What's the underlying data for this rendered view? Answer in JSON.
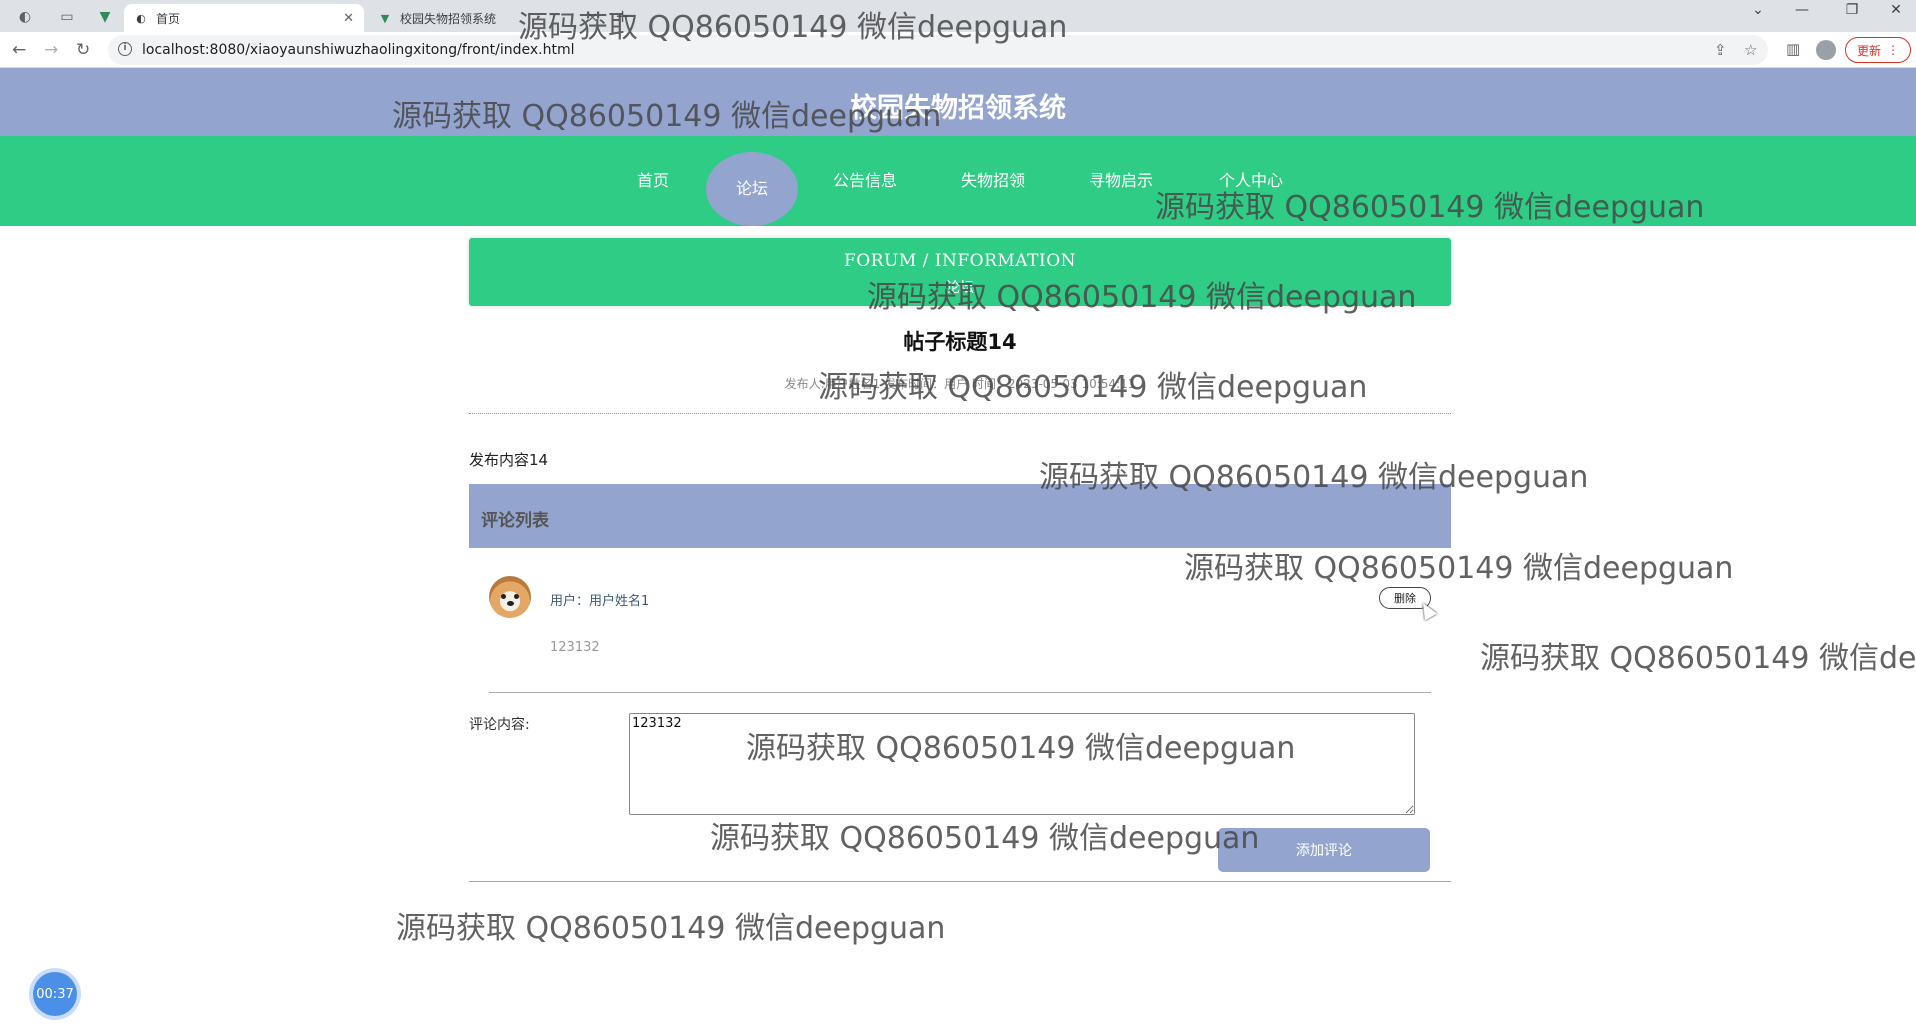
{
  "browser": {
    "tabs": [
      {
        "title": "首页",
        "active": true
      },
      {
        "title": "校园失物招领系统",
        "active": false
      }
    ],
    "url": "localhost:8080/xiaoyaunshiwuzhaolingxitong/front/index.html",
    "update_label": "更新"
  },
  "site": {
    "title": "校园失物招领系统",
    "nav": [
      {
        "label": "首页",
        "active": false
      },
      {
        "label": "论坛",
        "active": true
      },
      {
        "label": "公告信息",
        "active": false
      },
      {
        "label": "失物招领",
        "active": false
      },
      {
        "label": "寻物启示",
        "active": false
      },
      {
        "label": "个人中心",
        "active": false
      }
    ]
  },
  "banner": {
    "en": "FORUM / INFORMATION",
    "zh": "论坛"
  },
  "post": {
    "title": "帖子标题14",
    "meta": "发布人:用户姓名1   发布时间：用户   时间：2023-05-03 10:54:11",
    "content": "发布内容14"
  },
  "comments": {
    "header": "评论列表",
    "items": [
      {
        "user": "用户：用户姓名1",
        "text": "123132",
        "delete_label": "删除"
      }
    ]
  },
  "comment_form": {
    "label": "评论内容:",
    "value": "123132",
    "submit_label": "添加评论"
  },
  "recording": {
    "timer": "00:37"
  },
  "watermark": "源码获取 QQ86050149 微信deepguan"
}
